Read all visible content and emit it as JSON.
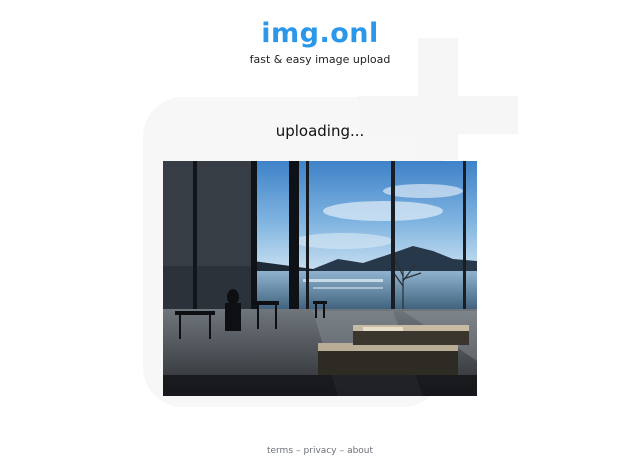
{
  "brand": {
    "name": "img.onl",
    "tagline": "fast & easy image upload"
  },
  "upload": {
    "status_text": "uploading..."
  },
  "footer": {
    "links": [
      "terms",
      "privacy",
      "about"
    ],
    "separator": "–"
  },
  "colors": {
    "brand": "#2b97ea",
    "background": "#ffffff",
    "watermark": "#f6f6f7"
  }
}
